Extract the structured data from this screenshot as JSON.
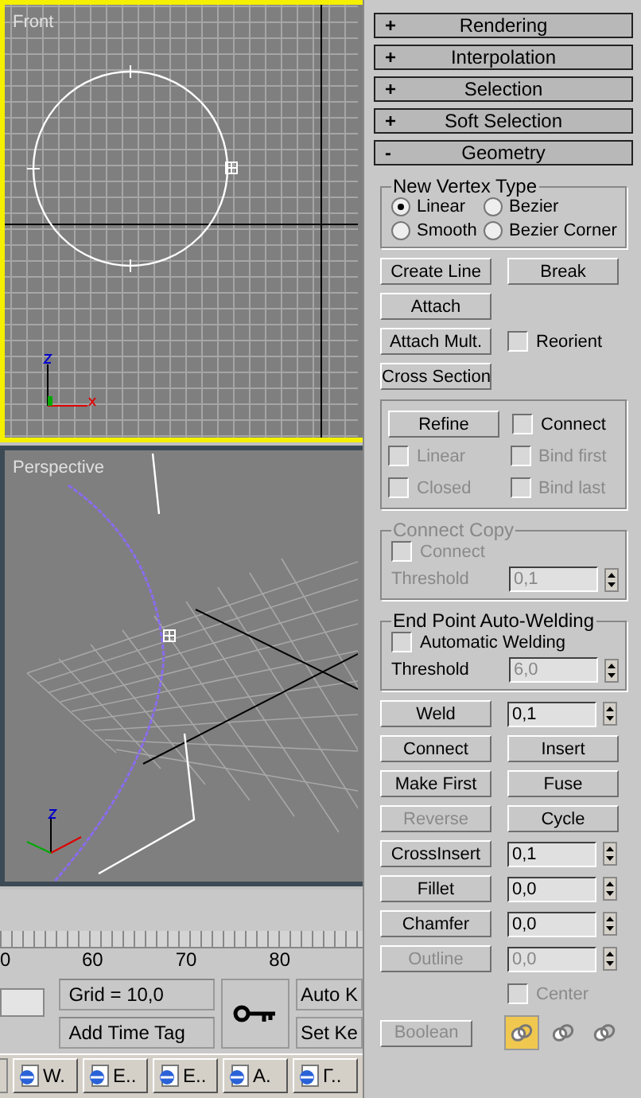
{
  "viewports": [
    {
      "label": "Front",
      "active": true,
      "kind": "front"
    },
    {
      "label": "Perspective",
      "active": false,
      "kind": "perspective"
    }
  ],
  "timeline": {
    "ticks": [
      "0",
      "60",
      "70",
      "80"
    ]
  },
  "status": {
    "grid": "Grid = 10,0",
    "time_tag": "Add Time Tag",
    "auto_key": "Auto K",
    "set_key": "Set Ke"
  },
  "taskbar": {
    "items": [
      "W.",
      "E..",
      "E..",
      "A.",
      "Г.."
    ]
  },
  "panel": {
    "rollouts": [
      {
        "sign": "+",
        "title": "Rendering"
      },
      {
        "sign": "+",
        "title": "Interpolation"
      },
      {
        "sign": "+",
        "title": "Selection"
      },
      {
        "sign": "+",
        "title": "Soft Selection"
      },
      {
        "sign": "-",
        "title": "Geometry"
      }
    ],
    "vertex_type": {
      "title": "New Vertex Type",
      "options": [
        {
          "label": "Linear",
          "selected": true
        },
        {
          "label": "Bezier",
          "selected": false
        },
        {
          "label": "Smooth",
          "selected": false
        },
        {
          "label": "Bezier Corner",
          "selected": false
        }
      ]
    },
    "top_rows": [
      {
        "left": {
          "kind": "button",
          "label": "Create Line",
          "disabled": false
        },
        "right": {
          "kind": "button",
          "label": "Break",
          "disabled": false
        }
      },
      {
        "left": {
          "kind": "button",
          "label": "Attach",
          "disabled": false
        }
      },
      {
        "left": {
          "kind": "button",
          "label": "Attach Mult.",
          "disabled": false
        },
        "right": {
          "kind": "checkbox",
          "label": "Reorient",
          "checked": false,
          "disabled": false
        }
      },
      {
        "left": {
          "kind": "button",
          "label": "Cross Section",
          "disabled": false
        }
      }
    ],
    "refine_rows": [
      {
        "left": {
          "kind": "button",
          "label": "Refine",
          "disabled": false
        },
        "right": {
          "kind": "checkbox",
          "label": "Connect",
          "checked": false,
          "disabled": false
        }
      },
      {
        "left": {
          "kind": "checkbox",
          "label": "Linear",
          "checked": false,
          "disabled": true
        },
        "right": {
          "kind": "checkbox",
          "label": "Bind first",
          "checked": false,
          "disabled": true
        }
      },
      {
        "left": {
          "kind": "checkbox",
          "label": "Closed",
          "checked": false,
          "disabled": true
        },
        "right": {
          "kind": "checkbox",
          "label": "Bind last",
          "checked": false,
          "disabled": true
        }
      }
    ],
    "groups": [
      {
        "title": "Connect Copy",
        "disabled": true,
        "checkbox": {
          "label": "Connect",
          "checked": false,
          "disabled": true
        },
        "threshold_label": "Threshold",
        "threshold": "0,1"
      },
      {
        "title": "End Point Auto-Welding",
        "disabled": false,
        "checkbox": {
          "label": "Automatic Welding",
          "checked": false,
          "disabled": false
        },
        "threshold_label": "Threshold",
        "threshold": "6,0"
      }
    ],
    "bottom_rows": [
      {
        "left": {
          "kind": "button",
          "label": "Weld",
          "disabled": false
        },
        "right": {
          "kind": "spinner",
          "value": "0,1",
          "disabled": false
        }
      },
      {
        "left": {
          "kind": "button",
          "label": "Connect",
          "disabled": false
        },
        "right": {
          "kind": "button",
          "label": "Insert",
          "disabled": false
        }
      },
      {
        "left": {
          "kind": "button",
          "label": "Make First",
          "disabled": false
        },
        "right": {
          "kind": "button",
          "label": "Fuse",
          "disabled": false
        }
      },
      {
        "left": {
          "kind": "button",
          "label": "Reverse",
          "disabled": true
        },
        "right": {
          "kind": "button",
          "label": "Cycle",
          "disabled": false
        }
      },
      {
        "left": {
          "kind": "button",
          "label": "CrossInsert",
          "disabled": false
        },
        "right": {
          "kind": "spinner",
          "value": "0,1",
          "disabled": false
        }
      },
      {
        "left": {
          "kind": "button",
          "label": "Fillet",
          "disabled": false
        },
        "right": {
          "kind": "spinner",
          "value": "0,0",
          "disabled": false
        }
      },
      {
        "left": {
          "kind": "button",
          "label": "Chamfer",
          "disabled": false
        },
        "right": {
          "kind": "spinner",
          "value": "0,0",
          "disabled": false
        }
      },
      {
        "left": {
          "kind": "button",
          "label": "Outline",
          "disabled": true
        },
        "right": {
          "kind": "spinner",
          "value": "0,0",
          "disabled": true
        }
      },
      {
        "right": {
          "kind": "checkbox",
          "label": "Center",
          "checked": false,
          "disabled": true
        }
      }
    ],
    "boolean": {
      "label": "Boolean",
      "disabled": true,
      "ops": [
        {
          "selected": true
        },
        {
          "selected": false
        },
        {
          "selected": false
        }
      ]
    }
  }
}
